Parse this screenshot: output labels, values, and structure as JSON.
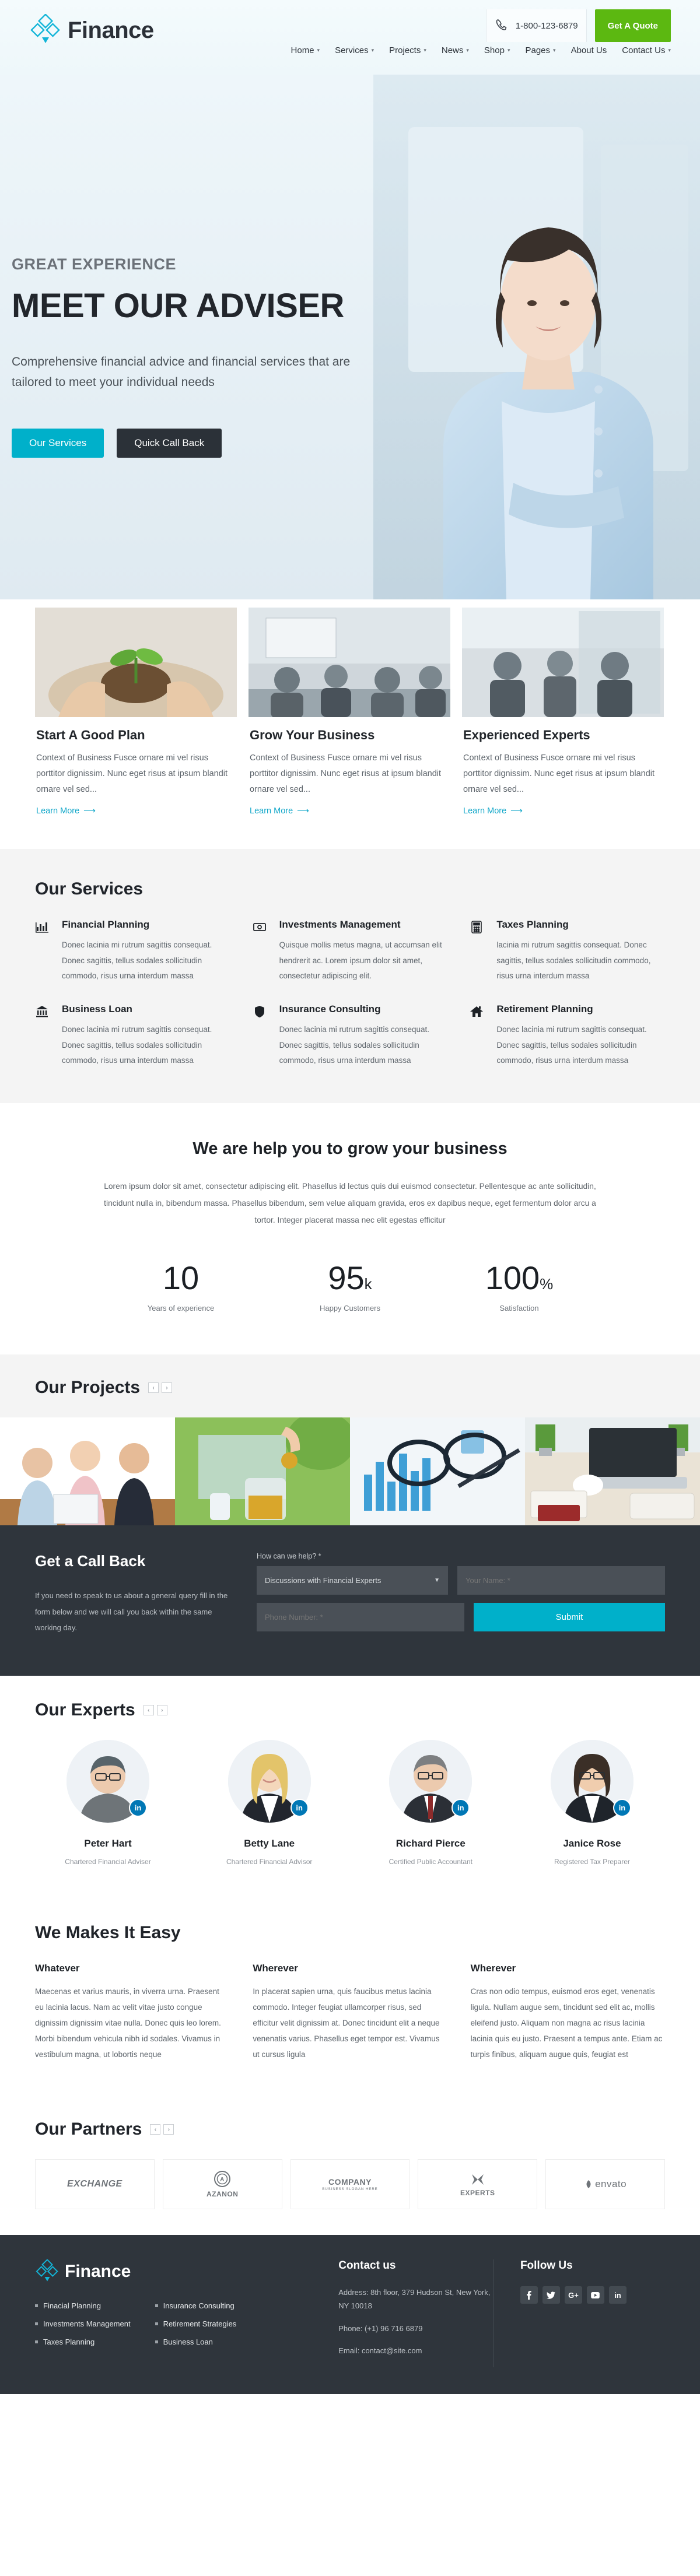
{
  "header": {
    "brand": "Finance",
    "phone": "1-800-123-6879",
    "quote_button": "Get A Quote",
    "nav": [
      {
        "label": "Home",
        "caret": true
      },
      {
        "label": "Services",
        "caret": true
      },
      {
        "label": "Projects",
        "caret": true
      },
      {
        "label": "News",
        "caret": true
      },
      {
        "label": "Shop",
        "caret": true
      },
      {
        "label": "Pages",
        "caret": true
      },
      {
        "label": "About Us",
        "caret": false
      },
      {
        "label": "Contact Us",
        "caret": true
      }
    ]
  },
  "hero": {
    "eyebrow": "GREAT EXPERIENCE",
    "title": "MEET OUR ADVISER",
    "paragraph": "Comprehensive financial advice and financial services that are tailored to meet your individual needs",
    "primary_button": "Our Services",
    "secondary_button": "Quick Call Back"
  },
  "cards": [
    {
      "title": "Start A Good Plan",
      "desc": "Context of Business Fusce ornare mi vel risus porttitor dignissim. Nunc eget risus at ipsum blandit ornare vel sed...",
      "link": "Learn More"
    },
    {
      "title": "Grow Your Business",
      "desc": "Context of Business Fusce ornare mi vel risus porttitor dignissim. Nunc eget risus at ipsum blandit ornare vel sed...",
      "link": "Learn More"
    },
    {
      "title": "Experienced Experts",
      "desc": "Context of Business Fusce ornare mi vel risus porttitor dignissim. Nunc eget risus at ipsum blandit ornare vel sed...",
      "link": "Learn More"
    }
  ],
  "services": {
    "title": "Our Services",
    "items": [
      {
        "icon": "bar-chart-icon",
        "title": "Financial Planning",
        "desc": "Donec lacinia mi rutrum sagittis consequat. Donec sagittis, tellus sodales sollicitudin commodo, risus urna interdum massa"
      },
      {
        "icon": "banknote-icon",
        "title": "Investments Management",
        "desc": "Quisque mollis metus magna, ut accumsan elit hendrerit ac. Lorem ipsum dolor sit amet, consectetur adipiscing elit."
      },
      {
        "icon": "calculator-icon",
        "title": "Taxes Planning",
        "desc": "lacinia mi rutrum sagittis consequat. Donec sagittis, tellus sodales sollicitudin commodo, risus urna interdum massa"
      },
      {
        "icon": "bank-icon",
        "title": "Business Loan",
        "desc": "Donec lacinia mi rutrum sagittis consequat. Donec sagittis, tellus sodales sollicitudin commodo, risus urna interdum massa"
      },
      {
        "icon": "shield-icon",
        "title": "Insurance Consulting",
        "desc": "Donec lacinia mi rutrum sagittis consequat. Donec sagittis, tellus sodales sollicitudin commodo, risus urna interdum massa"
      },
      {
        "icon": "home-icon",
        "title": "Retirement Planning",
        "desc": "Donec lacinia mi rutrum sagittis consequat. Donec sagittis, tellus sodales sollicitudin commodo, risus urna interdum massa"
      }
    ]
  },
  "grow": {
    "title": "We are help you to grow your business",
    "paragraph": "Lorem ipsum dolor sit amet, consectetur adipiscing elit. Phasellus id lectus quis dui euismod consectetur. Pellentesque ac ante sollicitudin, tincidunt nulla in, bibendum massa. Phasellus bibendum, sem velue aliquam gravida, eros ex dapibus neque, eget fermentum dolor arcu a tortor. Integer placerat massa nec elit egestas efficitur",
    "counters": [
      {
        "number": "10",
        "suffix": "",
        "label": "Years of experience"
      },
      {
        "number": "95",
        "suffix": "k",
        "label": "Happy Customers"
      },
      {
        "number": "100",
        "suffix": "%",
        "label": "Satisfaction"
      }
    ]
  },
  "projects": {
    "title": "Our Projects",
    "prev": "‹",
    "next": "›",
    "slides": [
      "project-advisors-meeting",
      "project-savings-jar",
      "project-chart-glasses",
      "project-desk-laptop"
    ]
  },
  "callback": {
    "title": "Get a Call Back",
    "paragraph": "If you need to speak to us about a general query fill in the form below and we will call you back within the same working day.",
    "help_label": "How can we help? *",
    "select_value": "Discussions with Financial Experts",
    "name_placeholder": "Your Name: *",
    "phone_placeholder": "Phone Number: *",
    "submit": "Submit"
  },
  "experts": {
    "title": "Our Experts",
    "prev": "‹",
    "next": "›",
    "people": [
      {
        "name": "Peter Hart",
        "role": "Chartered Financial Adviser",
        "badge": "in"
      },
      {
        "name": "Betty Lane",
        "role": "Chartered Financial Advisor",
        "badge": "in"
      },
      {
        "name": "Richard Pierce",
        "role": "Certified Public Accountant",
        "badge": "in"
      },
      {
        "name": "Janice Rose",
        "role": "Registered Tax Preparer",
        "badge": "in"
      }
    ]
  },
  "easy": {
    "title": "We Makes It Easy",
    "columns": [
      {
        "heading": "Whatever",
        "body": "Maecenas et varius mauris, in viverra urna. Praesent eu lacinia lacus. Nam ac velit vitae justo congue dignissim dignissim vitae nulla. Donec quis leo lorem. Morbi bibendum vehicula nibh id sodales. Vivamus in vestibulum magna, ut lobortis neque"
      },
      {
        "heading": "Wherever",
        "body": "In placerat sapien urna, quis faucibus metus lacinia commodo. Integer feugiat ullamcorper risus, sed efficitur velit dignissim at. Donec tincidunt elit a neque venenatis varius. Phasellus eget tempor est. Vivamus ut cursus ligula"
      },
      {
        "heading": "Wherever",
        "body": "Cras non odio tempus, euismod eros eget, venenatis ligula. Nullam augue sem, tincidunt sed elit ac, mollis eleifend justo. Aliquam non magna ac risus lacinia lacinia quis eu justo. Praesent a tempus ante. Etiam ac turpis finibus, aliquam augue quis, feugiat est"
      }
    ]
  },
  "partners": {
    "title": "Our Partners",
    "prev": "‹",
    "next": "›",
    "logos": [
      {
        "name": "EXCHANGE",
        "sub": ""
      },
      {
        "name": "AZANON",
        "sub": ""
      },
      {
        "name": "COMPANY",
        "sub": "BUSINESS SLOGAN HERE"
      },
      {
        "name": "EXPERTS",
        "sub": ""
      },
      {
        "name": "envato",
        "sub": ""
      }
    ]
  },
  "footer": {
    "brand": "Finance",
    "links_col1": [
      "Finacial Planning",
      "Investments Management",
      "Taxes Planning"
    ],
    "links_col2": [
      "Insurance Consulting",
      "Retirement Strategies",
      "Business Loan"
    ],
    "contact_title": "Contact us",
    "address": "Address: 8th floor, 379 Hudson St, New York, NY 10018",
    "phone": "Phone: (+1) 96 716 6879",
    "email": "Email: contact@site.com",
    "follow_title": "Follow Us",
    "social": [
      "f",
      "🐦",
      "G+",
      "▶",
      "in"
    ]
  },
  "colors": {
    "accent_cyan": "#00b0ca",
    "accent_green": "#5cb811",
    "dark": "#2f353c",
    "link": "#12a7c9"
  }
}
